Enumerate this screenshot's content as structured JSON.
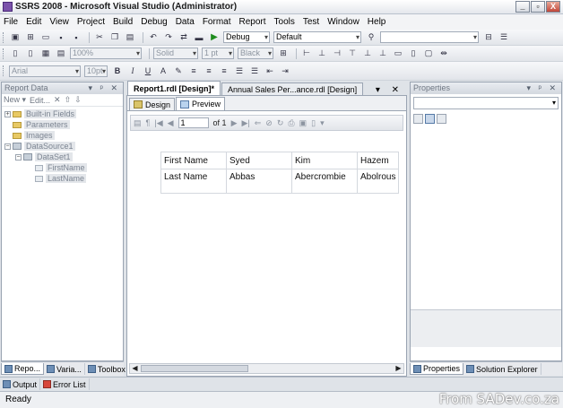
{
  "window": {
    "title": "SSRS 2008 - Microsoft Visual Studio (Administrator)",
    "controls": [
      "_",
      "▫",
      "X"
    ]
  },
  "menu": [
    "File",
    "Edit",
    "View",
    "Project",
    "Build",
    "Debug",
    "Data",
    "Format",
    "Report",
    "Tools",
    "Test",
    "Window",
    "Help"
  ],
  "toolbar1": {
    "config": "Debug",
    "platform": "Default"
  },
  "toolbar2": {
    "zoom": "100%",
    "border_style": "Solid",
    "border_width": "1 pt",
    "border_color": "Black"
  },
  "toolbar3": {
    "font": "Arial",
    "font_size": "10pt",
    "bold": "B",
    "italic": "I",
    "underline": "U",
    "font_color": "A"
  },
  "report_data": {
    "title": "Report Data",
    "header_controls": "▾ ᵖ ✕",
    "new_label": "New ▾",
    "edit_label": "Edit...",
    "tree": [
      {
        "label": "Built-in Fields",
        "kind": "folder",
        "expander": "+"
      },
      {
        "label": "Parameters",
        "kind": "folder",
        "expander": ""
      },
      {
        "label": "Images",
        "kind": "folder",
        "expander": ""
      },
      {
        "label": "DataSource1",
        "kind": "datasource",
        "expander": "−"
      },
      {
        "label": "DataSet1",
        "kind": "dataset",
        "expander": "−"
      },
      {
        "label": "FirstName",
        "kind": "field",
        "expander": ""
      },
      {
        "label": "LastName",
        "kind": "field",
        "expander": ""
      }
    ]
  },
  "left_tabs": [
    "Repo...",
    "Varia...",
    "Toolbox"
  ],
  "doc_tabs": {
    "active": "Report1.rdl [Design]*",
    "other": "Annual Sales Per...ance.rdl [Design]",
    "controls": "▾ ✕"
  },
  "designer_tabs": {
    "design": "Design",
    "preview": "Preview"
  },
  "viewer": {
    "page": "1",
    "of_label": "of 1"
  },
  "report_table": {
    "rows": [
      [
        "First Name",
        "Syed",
        "Kim",
        "Hazem"
      ],
      [
        "Last Name",
        "Abbas",
        "Abercrombie",
        "Abolrous"
      ]
    ]
  },
  "properties": {
    "title": "Properties",
    "header_controls": "▾ ᵖ ✕"
  },
  "right_tabs": [
    "Properties",
    "Solution Explorer"
  ],
  "bottom_tabs": [
    "Output",
    "Error List"
  ],
  "status": "Ready",
  "watermark": "From SADev.co.za"
}
